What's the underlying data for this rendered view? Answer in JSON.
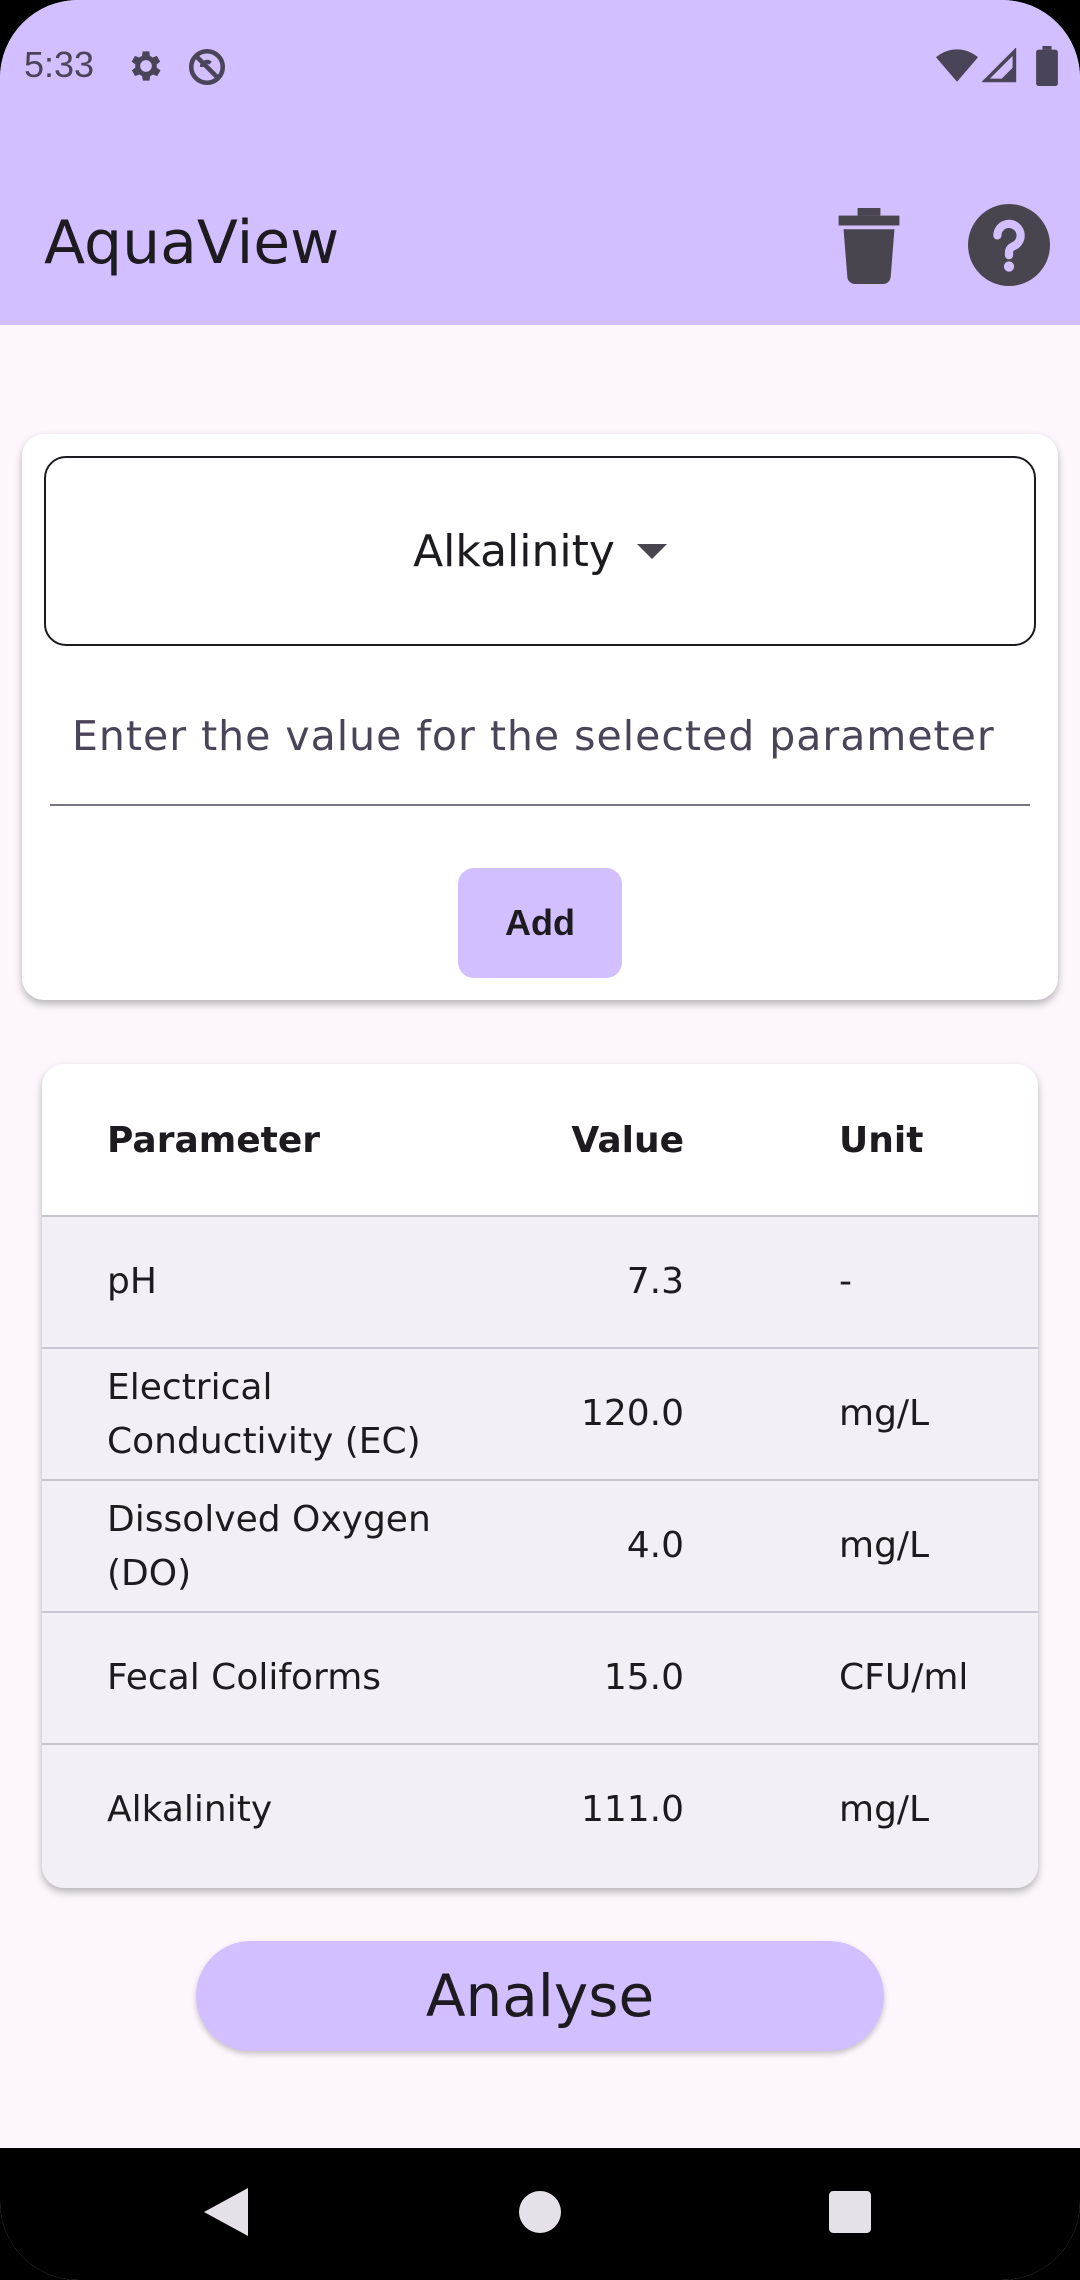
{
  "status_bar": {
    "time": "5:33",
    "icons": [
      "settings-icon",
      "no-sync-icon",
      "wifi-icon",
      "signal-icon",
      "battery-icon"
    ]
  },
  "app_bar": {
    "title": "AquaView",
    "actions": [
      "delete-icon",
      "help-icon"
    ]
  },
  "input_card": {
    "selected_parameter": "Alkalinity",
    "value_placeholder": "Enter the value for the selected parameter",
    "value": "",
    "add_label": "Add"
  },
  "table": {
    "headers": {
      "parameter": "Parameter",
      "value": "Value",
      "unit": "Unit"
    },
    "rows": [
      {
        "parameter": "pH",
        "value": "7.3",
        "unit": "-"
      },
      {
        "parameter": "Electrical Conductivity (EC)",
        "value": "120.0",
        "unit": "mg/L"
      },
      {
        "parameter": "Dissolved Oxygen (DO)",
        "value": "4.0",
        "unit": "mg/L"
      },
      {
        "parameter": "Fecal Coliforms",
        "value": "15.0",
        "unit": "CFU/ml"
      },
      {
        "parameter": "Alkalinity",
        "value": "111.0",
        "unit": "mg/L"
      }
    ]
  },
  "analyse_label": "Analyse",
  "nav_bar": [
    "back-icon",
    "home-icon",
    "recents-icon"
  ],
  "colors": {
    "primary_container": "#d2bfff",
    "surface": "#fdf7fd",
    "table_surface": "#f3eff7",
    "on_surface": "#1d1b20"
  }
}
